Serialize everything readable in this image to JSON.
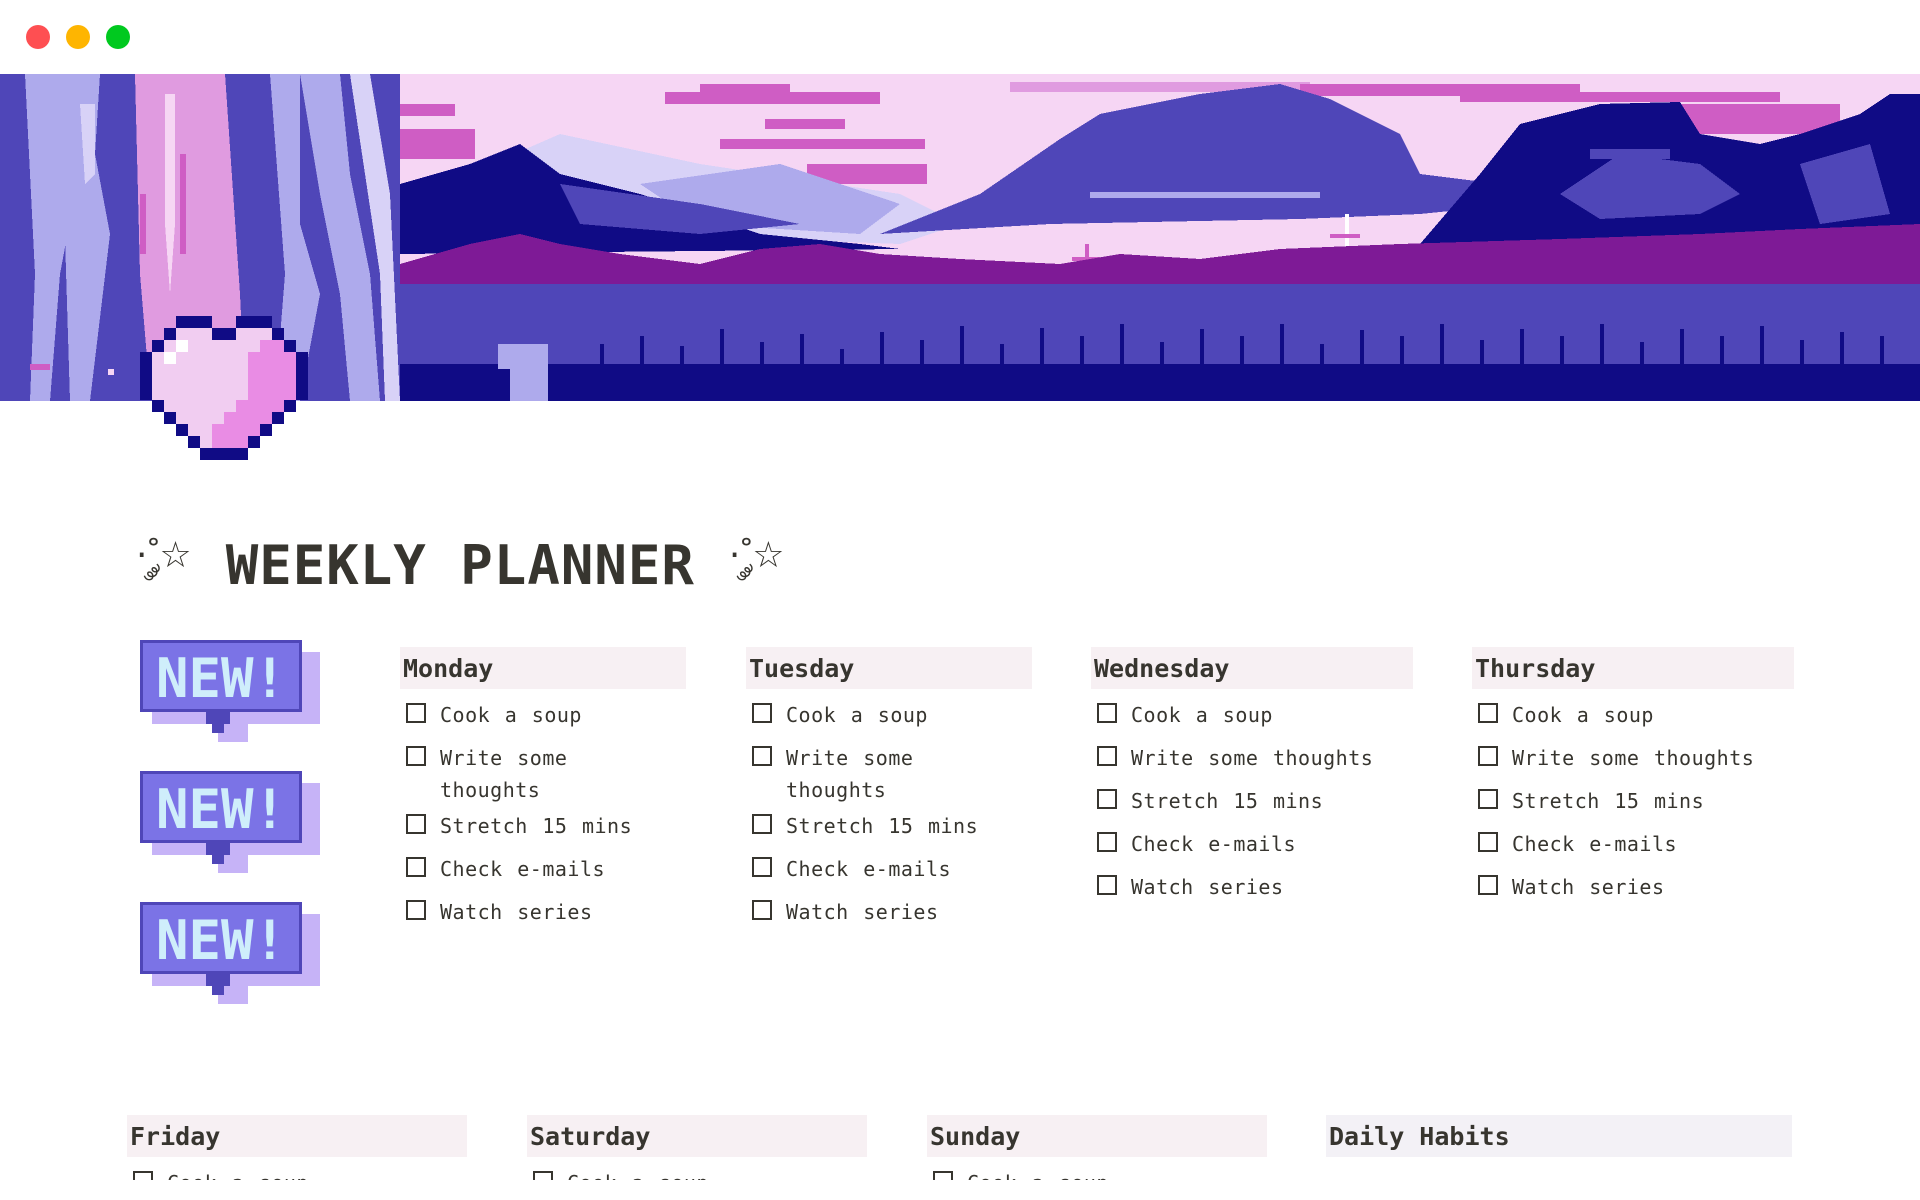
{
  "window": {
    "controls": [
      "close",
      "minimize",
      "maximize"
    ]
  },
  "colors": {
    "header_bg": "#f7f0f3",
    "habits_header_bg": "#f3f1f6",
    "text": "#37352f",
    "traffic_red": "#fe4f52",
    "traffic_yellow": "#feb501",
    "traffic_green": "#00c91f"
  },
  "page": {
    "icon": "pixel-heart-icon",
    "cover": "pixel-art-purple-landscape",
    "title_deco_left": "·˚༘☆",
    "title": "WEEKLY PLANNER",
    "title_deco_right": "·˚༘☆"
  },
  "stickers": [
    {
      "label": "NEW!"
    },
    {
      "label": "NEW!"
    },
    {
      "label": "NEW!"
    }
  ],
  "days": [
    {
      "name": "Monday",
      "tasks": [
        {
          "label": "Cook a soup",
          "checked": false
        },
        {
          "label": "Write some thoughts",
          "checked": false
        },
        {
          "label": "Stretch 15 mins",
          "checked": false
        },
        {
          "label": "Check e-mails",
          "checked": false
        },
        {
          "label": "Watch series",
          "checked": false
        }
      ]
    },
    {
      "name": "Tuesday",
      "tasks": [
        {
          "label": "Cook a soup",
          "checked": false
        },
        {
          "label": "Write some thoughts",
          "checked": false
        },
        {
          "label": "Stretch 15 mins",
          "checked": false
        },
        {
          "label": "Check e-mails",
          "checked": false
        },
        {
          "label": "Watch series",
          "checked": false
        }
      ]
    },
    {
      "name": "Wednesday",
      "tasks": [
        {
          "label": "Cook a soup",
          "checked": false
        },
        {
          "label": "Write some thoughts",
          "checked": false
        },
        {
          "label": "Stretch 15 mins",
          "checked": false
        },
        {
          "label": "Check e-mails",
          "checked": false
        },
        {
          "label": "Watch series",
          "checked": false
        }
      ]
    },
    {
      "name": "Thursday",
      "tasks": [
        {
          "label": "Cook a soup",
          "checked": false
        },
        {
          "label": "Write some thoughts",
          "checked": false
        },
        {
          "label": "Stretch 15 mins",
          "checked": false
        },
        {
          "label": "Check e-mails",
          "checked": false
        },
        {
          "label": "Watch series",
          "checked": false
        }
      ]
    },
    {
      "name": "Friday",
      "tasks": [
        {
          "label": "Cook a soup",
          "checked": false
        }
      ]
    },
    {
      "name": "Saturday",
      "tasks": [
        {
          "label": "Cook a soup",
          "checked": false
        }
      ]
    },
    {
      "name": "Sunday",
      "tasks": [
        {
          "label": "Cook a soup",
          "checked": false
        }
      ]
    }
  ],
  "habits": {
    "name": "Daily Habits"
  }
}
